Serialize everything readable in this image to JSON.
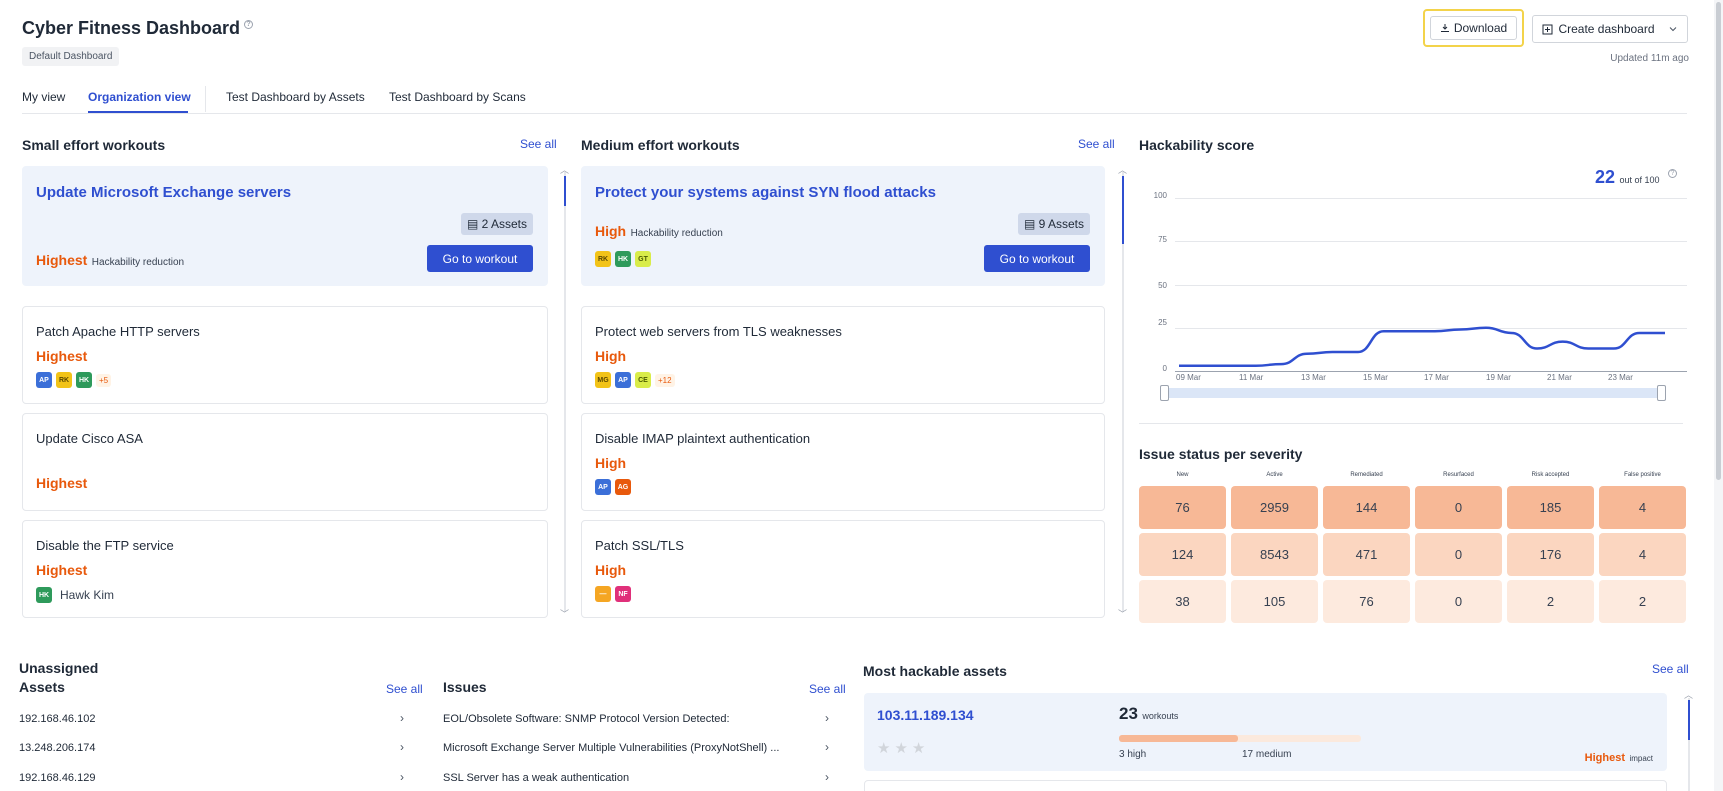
{
  "header": {
    "title": "Cyber Fitness Dashboard",
    "default_chip": "Default Dashboard",
    "download_label": "Download",
    "create_label": "Create dashboard",
    "updated": "Updated 11m ago"
  },
  "tabs": [
    {
      "label": "My view",
      "active": false
    },
    {
      "label": "Organization view",
      "active": true
    },
    {
      "label": "Test Dashboard by Assets",
      "active": false
    },
    {
      "label": "Test Dashboard by Scans",
      "active": false
    }
  ],
  "small_effort": {
    "title": "Small effort workouts",
    "see_all": "See all",
    "featured": {
      "title": "Update Microsoft Exchange servers",
      "assets": "2 Assets",
      "severity": "Highest",
      "severity_sub": "Hackability reduction",
      "cta": "Go to workout"
    },
    "items": [
      {
        "title": "Patch Apache HTTP servers",
        "severity": "Highest",
        "avatars": [
          "AP",
          "RK",
          "HK"
        ],
        "more": "+5"
      },
      {
        "title": "Update Cisco ASA",
        "severity": "Highest",
        "avatars": [],
        "more": ""
      },
      {
        "title": "Disable the FTP service",
        "severity": "Highest",
        "avatars": [
          "HK"
        ],
        "more": "",
        "name": "Hawk Kim"
      }
    ]
  },
  "medium_effort": {
    "title": "Medium effort workouts",
    "see_all": "See all",
    "featured": {
      "title": "Protect your systems against SYN flood attacks",
      "assets": "9 Assets",
      "severity": "High",
      "severity_sub": "Hackability reduction",
      "avatars": [
        "RK",
        "HK",
        "GT"
      ],
      "cta": "Go to workout"
    },
    "items": [
      {
        "title": "Protect web servers from TLS weaknesses",
        "severity": "High",
        "avatars": [
          "MG",
          "AP",
          "CE"
        ],
        "more": "+12"
      },
      {
        "title": "Disable IMAP plaintext authentication",
        "severity": "High",
        "avatars": [
          "AP",
          "AG"
        ],
        "more": ""
      },
      {
        "title": "Patch SSL/TLS",
        "severity": "High",
        "avatars": [
          "—",
          "NF"
        ],
        "more": ""
      }
    ]
  },
  "avatar_colors": {
    "AP": "#3b6fd8",
    "RK": "#f2c318",
    "HK": "#2e9a5b",
    "GT": "#d9ec4a",
    "MG": "#f2c318",
    "CE": "#d9ec4a",
    "AG": "#e8590c",
    "—": "#f5a623",
    "NF": "#e0307a"
  },
  "hackability": {
    "title": "Hackability score",
    "score": "22",
    "score_sub": "out of 100",
    "y_ticks": [
      "100",
      "75",
      "50",
      "25",
      "0"
    ],
    "x_ticks": [
      "09 Mar",
      "11 Mar",
      "13 Mar",
      "15 Mar",
      "17 Mar",
      "19 Mar",
      "21 Mar",
      "23 Mar"
    ]
  },
  "chart_data": {
    "type": "line",
    "title": "Hackability score",
    "x": [
      "09 Mar",
      "10 Mar",
      "11 Mar",
      "12 Mar",
      "13 Mar",
      "13.5 Mar",
      "14 Mar",
      "14.5 Mar",
      "15 Mar",
      "16 Mar",
      "17 Mar",
      "18 Mar",
      "19 Mar",
      "19.5 Mar",
      "20 Mar",
      "21 Mar",
      "22 Mar",
      "23 Mar",
      "24 Mar",
      "25 Mar"
    ],
    "values": [
      3,
      3,
      3,
      3,
      4,
      10,
      11,
      11,
      23,
      23,
      23,
      24,
      25,
      22,
      13,
      17,
      13,
      13,
      22,
      22
    ],
    "ylim": [
      0,
      100
    ],
    "y_ticks": [
      0,
      25,
      50,
      75,
      100
    ],
    "grid": true,
    "color": "#2f4fd0"
  },
  "severity_table": {
    "title": "Issue status per severity",
    "headers": [
      "New",
      "Active",
      "Remediated",
      "Resurfaced",
      "Risk accepted",
      "False positive"
    ],
    "rows": [
      [
        "76",
        "2959",
        "144",
        "0",
        "185",
        "4"
      ],
      [
        "124",
        "8543",
        "471",
        "0",
        "176",
        "4"
      ],
      [
        "38",
        "105",
        "76",
        "0",
        "2",
        "2"
      ]
    ],
    "row_colors": [
      "#f7b896",
      "#fbd6c0",
      "#fdeade"
    ]
  },
  "unassigned": {
    "title": "Unassigned",
    "assets_title": "Assets",
    "assets_see_all": "See all",
    "assets": [
      "192.168.46.102",
      "13.248.206.174",
      "192.168.46.129"
    ],
    "issues_title": "Issues",
    "issues_see_all": "See all",
    "issues": [
      "EOL/Obsolete Software: SNMP Protocol Version Detected:",
      "Microsoft Exchange Server Multiple Vulnerabilities (ProxyNotShell) ...",
      "SSL Server has a weak authentication"
    ]
  },
  "most_hackable": {
    "title": "Most hackable assets",
    "see_all": "See all",
    "asset": "103.11.189.134",
    "workouts_num": "23",
    "workouts_label": "workouts",
    "high_label": "3 high",
    "medium_label": "17 medium",
    "impact": "Highest",
    "impact_sub": "impact"
  }
}
